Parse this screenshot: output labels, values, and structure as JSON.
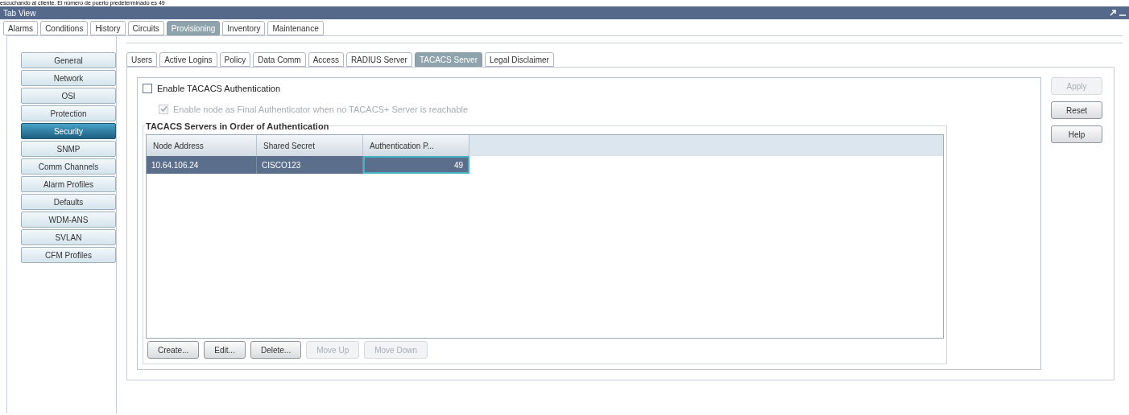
{
  "caption": "escuchando al cliente. El número de puerto predeterminado es 49",
  "window": {
    "title": "Tab View"
  },
  "tabs": [
    {
      "label": "Alarms",
      "selected": false
    },
    {
      "label": "Conditions",
      "selected": false
    },
    {
      "label": "History",
      "selected": false
    },
    {
      "label": "Circuits",
      "selected": false
    },
    {
      "label": "Provisioning",
      "selected": true
    },
    {
      "label": "Inventory",
      "selected": false
    },
    {
      "label": "Maintenance",
      "selected": false
    }
  ],
  "sidebar": {
    "items": [
      {
        "label": "General",
        "selected": false
      },
      {
        "label": "Network",
        "selected": false
      },
      {
        "label": "OSI",
        "selected": false
      },
      {
        "label": "Protection",
        "selected": false
      },
      {
        "label": "Security",
        "selected": true
      },
      {
        "label": "SNMP",
        "selected": false
      },
      {
        "label": "Comm Channels",
        "selected": false
      },
      {
        "label": "Alarm Profiles",
        "selected": false
      },
      {
        "label": "Defaults",
        "selected": false
      },
      {
        "label": "WDM-ANS",
        "selected": false
      },
      {
        "label": "SVLAN",
        "selected": false
      },
      {
        "label": "CFM Profiles",
        "selected": false
      }
    ]
  },
  "subtabs": [
    {
      "label": "Users",
      "selected": false
    },
    {
      "label": "Active Logins",
      "selected": false
    },
    {
      "label": "Policy",
      "selected": false
    },
    {
      "label": "Data Comm",
      "selected": false
    },
    {
      "label": "Access",
      "selected": false
    },
    {
      "label": "RADIUS Server",
      "selected": false
    },
    {
      "label": "TACACS Server",
      "selected": true
    },
    {
      "label": "Legal Disclaimer",
      "selected": false
    }
  ],
  "options": [
    {
      "label": "Enable TACACS Authentication",
      "checked": false,
      "disabled": false
    },
    {
      "label": "Enable node as Final Authenticator when no TACACS+ Server is reachable",
      "checked": true,
      "disabled": true
    }
  ],
  "servers": {
    "title": "TACACS Servers in Order of Authentication",
    "table": {
      "columns": [
        "Node Address",
        "Shared Secret",
        "Authentication P..."
      ],
      "rows": [
        {
          "cells": [
            "10.64.106.24",
            "CISCO123",
            "49"
          ],
          "selected": true
        }
      ]
    },
    "buttons": [
      {
        "label": "Create...",
        "disabled": false
      },
      {
        "label": "Edit...",
        "disabled": false
      },
      {
        "label": "Delete...",
        "disabled": false
      },
      {
        "label": "Move Up",
        "disabled": true
      },
      {
        "label": "Move Down",
        "disabled": true
      }
    ]
  },
  "side_buttons": [
    {
      "label": "Apply",
      "disabled": true
    },
    {
      "label": "Reset",
      "disabled": false
    },
    {
      "label": "Help",
      "disabled": false
    }
  ]
}
